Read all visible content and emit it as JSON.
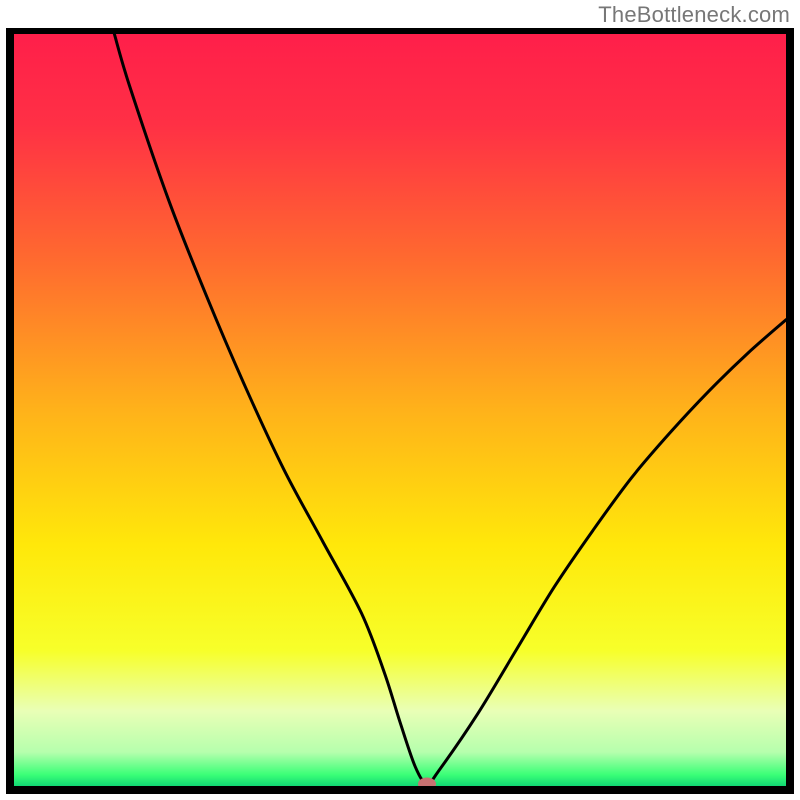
{
  "watermark": "TheBottleneck.com",
  "chart_data": {
    "type": "line",
    "title": "",
    "xlabel": "",
    "ylabel": "",
    "xlim": [
      0,
      100
    ],
    "ylim": [
      0,
      100
    ],
    "x": [
      13,
      15,
      20,
      25,
      30,
      35,
      40,
      45,
      48,
      50,
      52,
      53.5,
      55,
      60,
      65,
      70,
      75,
      80,
      85,
      90,
      95,
      100
    ],
    "values": [
      100,
      93,
      78,
      65,
      53,
      42,
      32.5,
      23,
      15,
      8.5,
      2.5,
      0.3,
      2.0,
      9.5,
      18,
      26.5,
      34,
      41,
      47,
      52.5,
      57.5,
      62
    ],
    "minimum_marker": {
      "x": 53.5,
      "y": 0.3,
      "color": "#c77272"
    },
    "gradient_stops": [
      {
        "offset": 0.0,
        "color": "#ff1f4a"
      },
      {
        "offset": 0.12,
        "color": "#ff3045"
      },
      {
        "offset": 0.3,
        "color": "#ff6a2f"
      },
      {
        "offset": 0.5,
        "color": "#ffb21a"
      },
      {
        "offset": 0.68,
        "color": "#ffe80a"
      },
      {
        "offset": 0.82,
        "color": "#f7ff2a"
      },
      {
        "offset": 0.9,
        "color": "#e9ffb6"
      },
      {
        "offset": 0.955,
        "color": "#b6ffad"
      },
      {
        "offset": 0.985,
        "color": "#3bff77"
      },
      {
        "offset": 1.0,
        "color": "#11d874"
      }
    ]
  }
}
